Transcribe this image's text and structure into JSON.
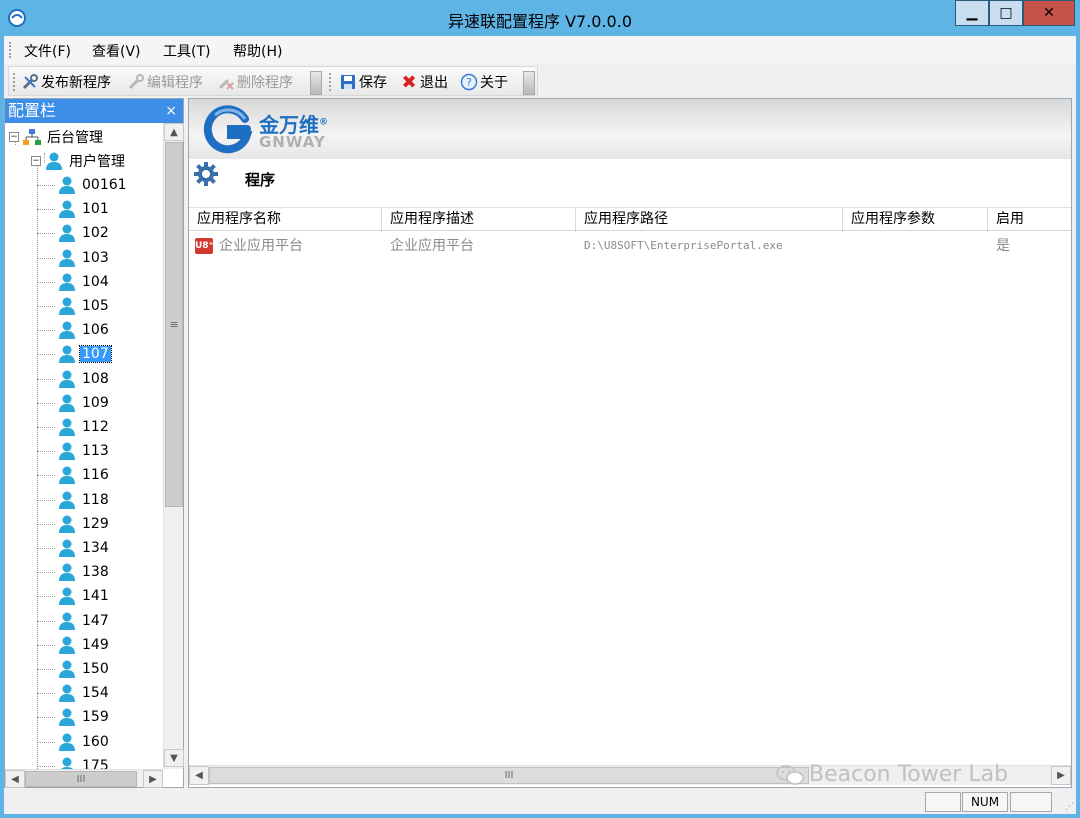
{
  "window": {
    "title": "异速联配置程序 V7.0.0.0"
  },
  "menubar": {
    "items": [
      "文件(F)",
      "查看(V)",
      "工具(T)",
      "帮助(H)"
    ]
  },
  "toolbar": {
    "publish": "发布新程序",
    "edit": "编辑程序",
    "delete": "删除程序",
    "save": "保存",
    "exit": "退出",
    "about": "关于"
  },
  "panel": {
    "title": "配置栏",
    "close_glyph": "×",
    "root": "后台管理",
    "group": "用户管理",
    "users": [
      "00161",
      "101",
      "102",
      "103",
      "104",
      "105",
      "106",
      "107",
      "108",
      "109",
      "112",
      "113",
      "116",
      "118",
      "129",
      "134",
      "138",
      "141",
      "147",
      "149",
      "150",
      "154",
      "159",
      "160",
      "175"
    ],
    "selected_user": "107"
  },
  "brand": {
    "cn": "金万维",
    "reg": "®",
    "en": "GNWAY"
  },
  "section": {
    "title": "程序"
  },
  "grid": {
    "columns": [
      "应用程序名称",
      "应用程序描述",
      "应用程序路径",
      "应用程序参数",
      "启用"
    ],
    "rows": [
      {
        "name": "企业应用平台",
        "icon_text": "U8⁺",
        "desc": "企业应用平台",
        "path": "D:\\U8SOFT\\EnterprisePortal.exe",
        "params": "",
        "enabled": "是"
      }
    ]
  },
  "watermark": {
    "text": "Beacon Tower Lab"
  },
  "statusbar": {
    "num": "NUM"
  },
  "colors": {
    "titlebar": "#5fb4e6",
    "panel_header": "#3d8ee6",
    "selection": "#3399ff",
    "brand_blue": "#1e6fc2"
  }
}
